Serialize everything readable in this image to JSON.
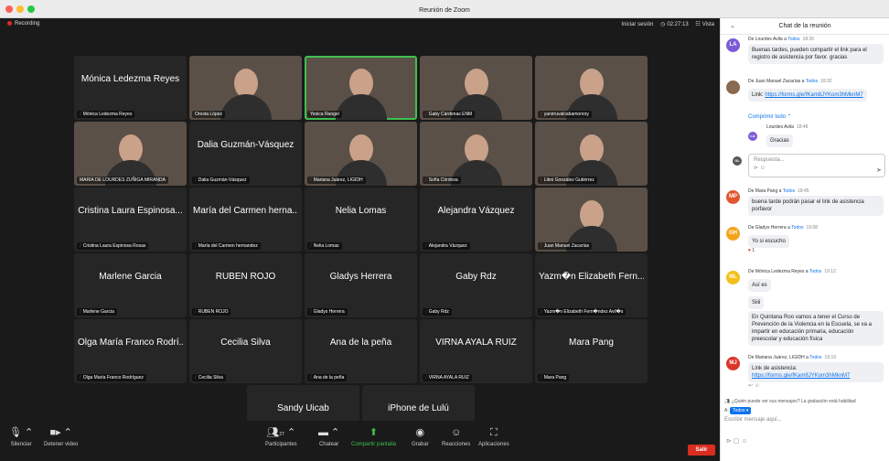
{
  "window": {
    "title": "Reunión de Zoom"
  },
  "meeting": {
    "recording": "Recording",
    "signin": "Iniciar sesión",
    "timer": "02:27:13",
    "view": "Vista"
  },
  "tiles": [
    {
      "big": "Mónica Ledezma Reyes",
      "name": "Mónica Ledezma Reyes",
      "video": false,
      "mic": true
    },
    {
      "big": "",
      "name": "Oresta López",
      "video": true,
      "mic": false
    },
    {
      "big": "",
      "name": "Yesica Rangel",
      "video": true,
      "mic": false,
      "active": true
    },
    {
      "big": "",
      "name": "Gaby Cárdenas ENM",
      "video": true,
      "mic": true
    },
    {
      "big": "",
      "name": "yanirruvalcabamonroy",
      "video": true,
      "mic": true
    },
    {
      "big": "",
      "name": "MARIA DE LOURDES ZUÑIGA MIRANDA",
      "video": true,
      "mic": false
    },
    {
      "big": "Dalia Guzmán-Vásquez",
      "name": "Dalia Guzmán-Vásquez",
      "video": false,
      "mic": true
    },
    {
      "big": "",
      "name": "Mariana Juárez, LIGIDH",
      "video": true,
      "mic": true
    },
    {
      "big": "",
      "name": "Sofía Córdova",
      "video": true,
      "mic": true
    },
    {
      "big": "",
      "name": "Libni González Gutiérrez",
      "video": true,
      "mic": true
    },
    {
      "big": "Cristina Laura Espinosa...",
      "name": "Cristina Laura Espinosa Rosas",
      "video": false,
      "mic": true
    },
    {
      "big": "María del Carmen herna...",
      "name": "María del Carmen hernandez",
      "video": false,
      "mic": true
    },
    {
      "big": "Nelia Lomas",
      "name": "Nelia Lomas",
      "video": false,
      "mic": true
    },
    {
      "big": "Alejandra Vázquez",
      "name": "Alejandra Vázquez",
      "video": false,
      "mic": true
    },
    {
      "big": "",
      "name": "Juan Manuel Zacarías",
      "video": true,
      "mic": true
    },
    {
      "big": "Marlene Garcia",
      "name": "Marlene Garcia",
      "video": false,
      "mic": true
    },
    {
      "big": "RUBEN ROJO",
      "name": "RUBEN ROJO",
      "video": false,
      "mic": true
    },
    {
      "big": "Gladys Herrera",
      "name": "Gladys Herrera",
      "video": false,
      "mic": true
    },
    {
      "big": "Gaby Rdz",
      "name": "Gaby Rdz",
      "video": false,
      "mic": true
    },
    {
      "big": "Yazm�n Elizabeth Fern...",
      "name": "Yazm�n Elizabeth Fern�ndez Avil�s",
      "video": false,
      "mic": true
    },
    {
      "big": "Olga María Franco Rodrí...",
      "name": "Olga María Franco Rodríguez",
      "video": false,
      "mic": true
    },
    {
      "big": "Cecilia Silva",
      "name": "Cecilia Silva",
      "video": false,
      "mic": true
    },
    {
      "big": "Ana de la peña",
      "name": "Ana de la peña",
      "video": false,
      "mic": true
    },
    {
      "big": "VIRNA AYALA RUIZ",
      "name": "VIRNA AYALA RUIZ",
      "video": false,
      "mic": true
    },
    {
      "big": "Mara Pang",
      "name": "Mara Pang",
      "video": false,
      "mic": true
    },
    {
      "big": "Sandy Uicab",
      "name": "Sandy Uicab",
      "video": false,
      "mic": true
    },
    {
      "big": "iPhone de Lulú",
      "name": "iPhone de Lulú",
      "video": false,
      "mic": true
    }
  ],
  "toolbar": {
    "mute": "Silenciar",
    "video": "Detener video",
    "participants": "Participantes",
    "participants_count": "27",
    "chat": "Chatear",
    "share": "Compartir pantalla",
    "record": "Grabar",
    "reactions": "Reacciones",
    "apps": "Aplicaciones",
    "leave": "Salir"
  },
  "chat": {
    "title": "Chat de la reunión",
    "messages": [
      {
        "initials": "LA",
        "color": "#7c5ad6",
        "from": "De Lourdes Avila a",
        "to": "Todos",
        "time": "18:26",
        "text": "Buenas tardes, pueden compartir el link para el registro de asistencia por favor. gracias"
      },
      {
        "initials": "",
        "color": "#8a6a50",
        "from": "De Juan Manuel Zacarías a",
        "to": "Todos",
        "time": "18:32",
        "text": "Link: ",
        "link": "https://forms.gle/fKam8JYKom3hMknM7"
      },
      {
        "initials": "MP",
        "color": "#e0562f",
        "from": "De Mara Pang a",
        "to": "Todos",
        "time": "18:45",
        "text": "buena tarde podrán pasar el link de asistencia porfavor"
      },
      {
        "initials": "GH",
        "color": "#f2a51a",
        "from": "De Gladys Herrera a",
        "to": "Todos",
        "time": "19:08",
        "text": "Yo si escucho"
      },
      {
        "initials": "ML",
        "color": "#f2c01a",
        "from": "De Mónica Ledezma Reyes a",
        "to": "Todos",
        "time": "19:12",
        "text": "Así es"
      },
      {
        "initials": "MJ",
        "color": "#d9352b",
        "from": "De Mariana Juárez, LIGIDH a",
        "to": "Todos",
        "time": "19:19",
        "text": "Link de asistencia: ",
        "link": "https://forms.gle/fKam8JYKom3hMknM7"
      }
    ],
    "collapse": "Comprimir todo",
    "reply_from": "Lourdes Avila",
    "reply_time": "18:48",
    "reply_text": "Gracias",
    "reply_placeholder": "Respuesta...",
    "reaction_count": "1",
    "extra1": "Siiii",
    "extra2": "En Quintana Roo vamos a tener el Curso de Prevención de la Violencia en la Escuela, se va a impartir en educación primaria, educación preescolar y educación física",
    "notice": "¿Quién puede ver sus mensajes? La grabación está habilitad",
    "to_label": "A:",
    "to_value": "Todos",
    "input_placeholder": "Escribir mensaje aquí..."
  }
}
